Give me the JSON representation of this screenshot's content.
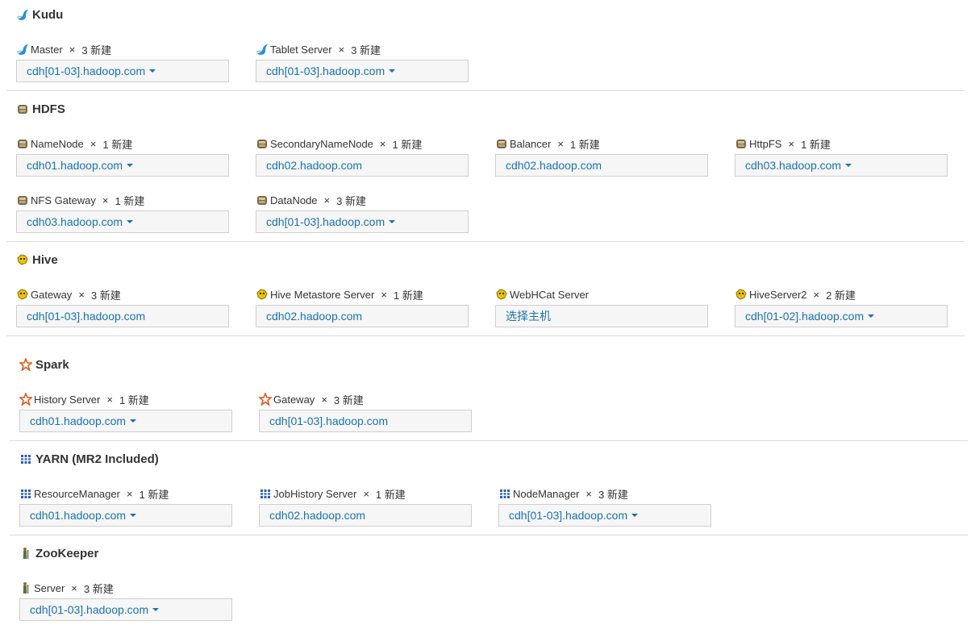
{
  "icons": {
    "kudu": "kudu-icon",
    "hdfs": "hdfs-icon",
    "hive": "hive-icon",
    "spark": "spark-icon",
    "yarn": "yarn-icon",
    "zookeeper": "zookeeper-icon"
  },
  "colors": {
    "link": "#1a72b0",
    "box_bg": "#f6f6f6",
    "box_border": "#cfcfcf"
  },
  "sections": {
    "kudu": {
      "title": "Kudu",
      "roles": [
        {
          "name": "Master",
          "remove": "×",
          "count": "3 新建",
          "host": "cdh[01-03].hadoop.com",
          "dropdown": true
        },
        {
          "name": "Tablet Server",
          "remove": "×",
          "count": "3 新建",
          "host": "cdh[01-03].hadoop.com",
          "dropdown": true
        }
      ]
    },
    "hdfs": {
      "title": "HDFS",
      "roles": [
        {
          "name": "NameNode",
          "remove": "×",
          "count": "1 新建",
          "host": "cdh01.hadoop.com",
          "dropdown": true
        },
        {
          "name": "SecondaryNameNode",
          "remove": "×",
          "count": "1 新建",
          "host": "cdh02.hadoop.com",
          "dropdown": false
        },
        {
          "name": "Balancer",
          "remove": "×",
          "count": "1 新建",
          "host": "cdh02.hadoop.com",
          "dropdown": false
        },
        {
          "name": "HttpFS",
          "remove": "×",
          "count": "1 新建",
          "host": "cdh03.hadoop.com",
          "dropdown": true
        },
        {
          "name": "NFS Gateway",
          "remove": "×",
          "count": "1 新建",
          "host": "cdh03.hadoop.com",
          "dropdown": true
        },
        {
          "name": "DataNode",
          "remove": "×",
          "count": "3 新建",
          "host": "cdh[01-03].hadoop.com",
          "dropdown": true
        }
      ]
    },
    "hive": {
      "title": "Hive",
      "roles": [
        {
          "name": "Gateway",
          "remove": "×",
          "count": "3 新建",
          "host": "cdh[01-03].hadoop.com",
          "dropdown": false
        },
        {
          "name": "Hive Metastore Server",
          "remove": "×",
          "count": "1 新建",
          "host": "cdh02.hadoop.com",
          "dropdown": false
        },
        {
          "name": "WebHCat Server",
          "remove": "",
          "count": "",
          "host": "选择主机",
          "dropdown": false
        },
        {
          "name": "HiveServer2",
          "remove": "×",
          "count": "2 新建",
          "host": "cdh[01-02].hadoop.com",
          "dropdown": true
        }
      ]
    },
    "spark": {
      "title": "Spark",
      "roles": [
        {
          "name": "History Server",
          "remove": "×",
          "count": "1 新建",
          "host": "cdh01.hadoop.com",
          "dropdown": true
        },
        {
          "name": "Gateway",
          "remove": "×",
          "count": "3 新建",
          "host": "cdh[01-03].hadoop.com",
          "dropdown": false
        }
      ]
    },
    "yarn": {
      "title": "YARN (MR2 Included)",
      "roles": [
        {
          "name": "ResourceManager",
          "remove": "×",
          "count": "1 新建",
          "host": "cdh01.hadoop.com",
          "dropdown": true
        },
        {
          "name": "JobHistory Server",
          "remove": "×",
          "count": "1 新建",
          "host": "cdh02.hadoop.com",
          "dropdown": false
        },
        {
          "name": "NodeManager",
          "remove": "×",
          "count": "3 新建",
          "host": "cdh[01-03].hadoop.com",
          "dropdown": true
        }
      ]
    },
    "zookeeper": {
      "title": "ZooKeeper",
      "roles": [
        {
          "name": "Server",
          "remove": "×",
          "count": "3 新建",
          "host": "cdh[01-03].hadoop.com",
          "dropdown": true
        }
      ]
    }
  }
}
